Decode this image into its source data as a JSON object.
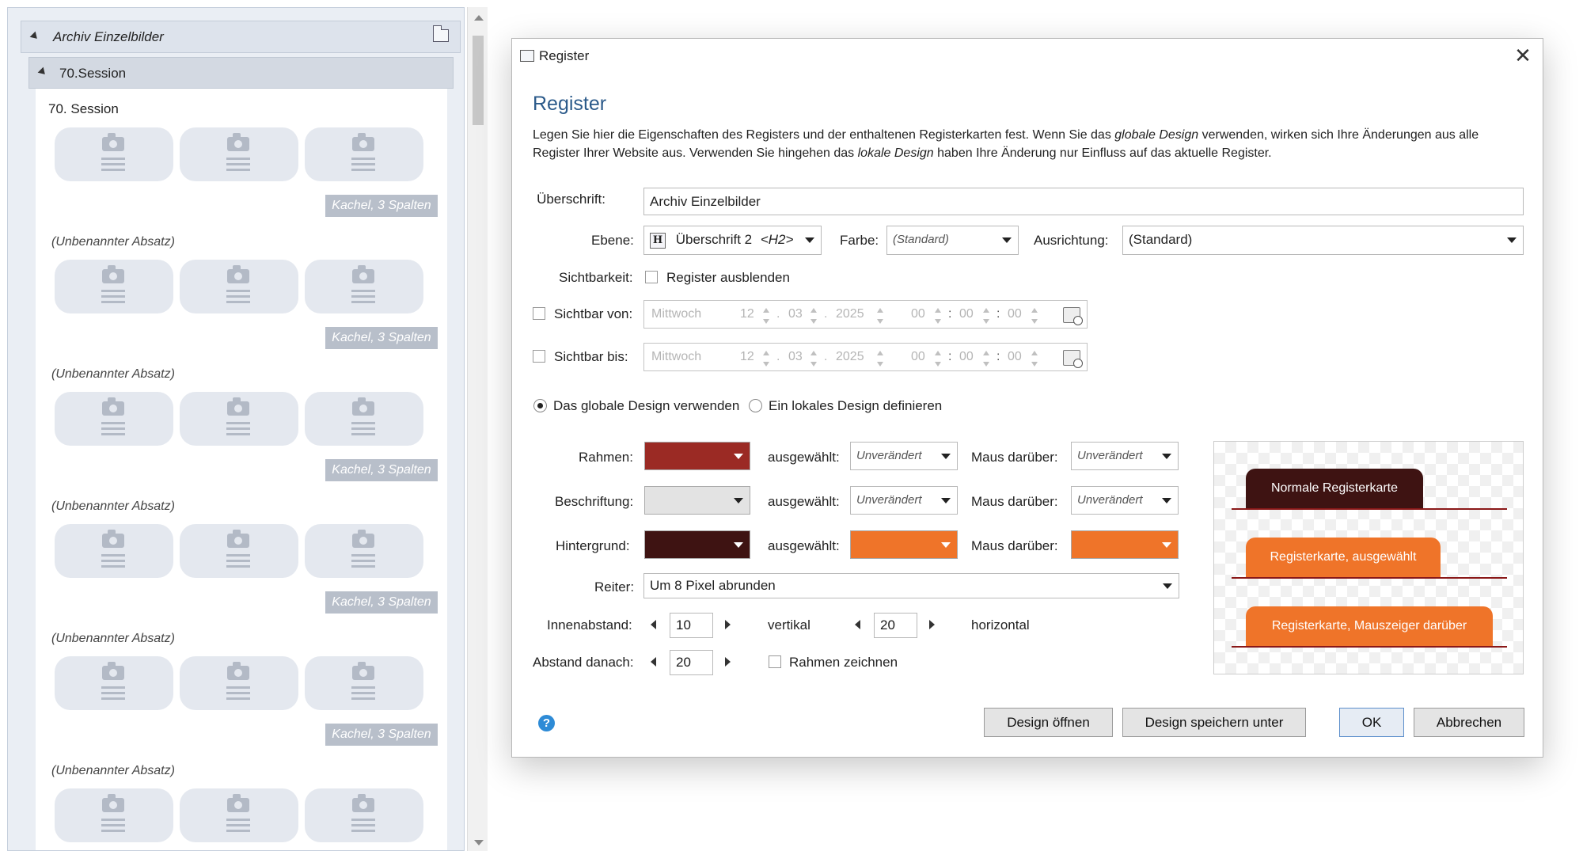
{
  "left_panel": {
    "archive_title": "Archiv Einzelbilder",
    "session_header": "70.Session",
    "content_title": "70. Session",
    "kachel_label": "Kachel, 3 Spalten",
    "unnamed_paragraph": "(Unbenannter Absatz)"
  },
  "dialog": {
    "window_title": "Register",
    "close_symbol": "✕",
    "heading": "Register",
    "description_parts": [
      "Legen Sie hier die Eigenschaften des Registers und der enthaltenen Registerkarten fest. Wenn Sie das ",
      "globale Design",
      " verwenden, wirken sich Ihre Änderungen aus alle Register Ihrer Website aus. Verwenden Sie hingehen das ",
      "lokale Design",
      " haben Ihre Änderung nur Einfluss auf das aktuelle Register."
    ],
    "ueberschrift_label": "Überschrift:",
    "ueberschrift_value": "Archiv Einzelbilder",
    "ebene_label": "Ebene:",
    "ebene_icon": "H",
    "ebene_value": "Überschrift 2",
    "ebene_tag": "<H2>",
    "farbe_label": "Farbe:",
    "farbe_value": "(Standard)",
    "ausrichtung_label": "Ausrichtung:",
    "ausrichtung_value": "(Standard)",
    "sichtbarkeit_label": "Sichtbarkeit:",
    "register_ausblenden": "Register ausblenden",
    "sichtbar_von_label": "Sichtbar von:",
    "sichtbar_bis_label": "Sichtbar bis:",
    "date": {
      "weekday": "Mittwoch",
      "day": "12",
      "month": "03",
      "year": "2025",
      "hour": "00",
      "minute": "00",
      "second": "00",
      "dot": ".",
      "colon": ":"
    },
    "radio_global": "Das globale Design verwenden",
    "radio_local": "Ein lokales Design definieren",
    "rahmen_label": "Rahmen:",
    "beschriftung_label": "Beschriftung:",
    "hintergrund_label": "Hintergrund:",
    "ausgewaehlt_label": "ausgewählt:",
    "maus_label": "Maus darüber:",
    "unveraendert": "Unverändert",
    "reiter_label": "Reiter:",
    "reiter_value": "Um 8 Pixel abrunden",
    "innenabstand_label": "Innenabstand:",
    "innen_vertikal_value": "10",
    "vertikal_label": "vertikal",
    "innen_horizontal_value": "20",
    "horizontal_label": "horizontal",
    "abstand_label": "Abstand danach:",
    "abstand_value": "20",
    "rahmen_zeichnen": "Rahmen zeichnen",
    "preview_tabs": [
      "Normale Registerkarte",
      "Registerkarte, ausgewählt",
      "Registerkarte, Mauszeiger darüber"
    ],
    "help_symbol": "?",
    "buttons": {
      "design_open": "Design öffnen",
      "design_save": "Design speichern unter",
      "ok": "OK",
      "cancel": "Abbrechen"
    }
  },
  "colors": {
    "rahmen": "#9b2a24",
    "beschriftung": "#e3e3e3",
    "hintergrund": "#3e1312",
    "orange": "#ef7429",
    "heading_blue": "#2b5a8a"
  }
}
